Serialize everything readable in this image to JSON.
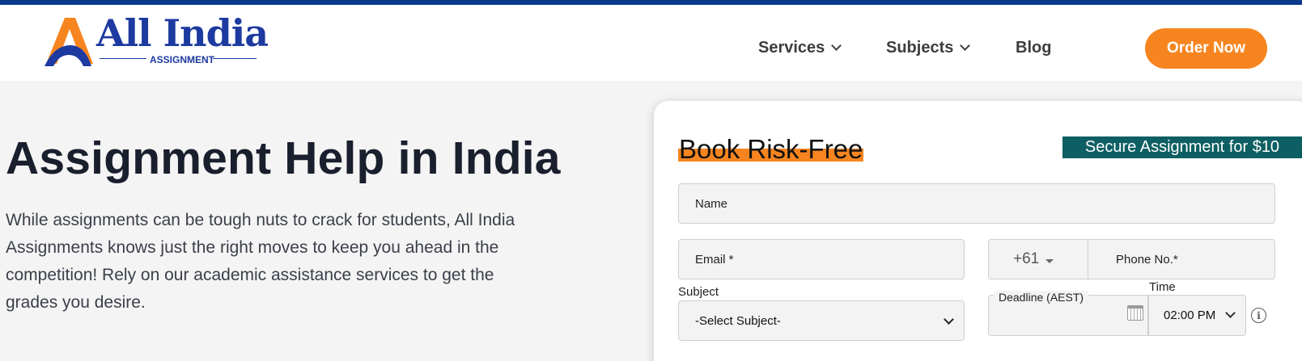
{
  "brand": {
    "name": "All India",
    "subname": "ASSIGNMENT",
    "colors": {
      "primary": "#1d3aa0",
      "accent": "#f7851f",
      "topbar": "#0b3a8a",
      "teal": "#0e5f63"
    }
  },
  "nav": {
    "items": [
      {
        "label": "Services",
        "has_dropdown": true
      },
      {
        "label": "Subjects",
        "has_dropdown": true
      },
      {
        "label": "Blog",
        "has_dropdown": false
      }
    ],
    "order_button": "Order Now"
  },
  "hero": {
    "title": "Assignment Help in India",
    "description": "While assignments can be tough nuts to crack for students, All India Assignments knows just the right moves to keep you ahead in the competition! Rely on our academic assistance services to get the grades you desire."
  },
  "form": {
    "title": "Book Risk-Free",
    "badge": "Secure Assignment for $10",
    "name_placeholder": "Name",
    "email_placeholder": "Email *",
    "country_code": "+61",
    "phone_placeholder": "Phone No.*",
    "subject_label": "Subject",
    "subject_value": "-Select Subject-",
    "deadline_label": "Deadline (AEST)",
    "time_label": "Time",
    "time_value": "02:00 PM",
    "icons": {
      "calendar": "calendar-icon",
      "info": "info-icon"
    }
  }
}
